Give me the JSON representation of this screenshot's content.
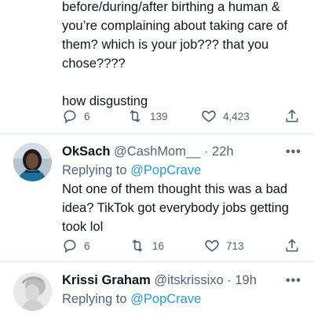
{
  "top_tweet": {
    "lines": [
      "before/during/after birthing a human &",
      "you’re complaining about taking care of",
      "them? which is your job??? that you",
      "chose????",
      "",
      "how disgusting"
    ],
    "stats": {
      "replies": "6",
      "retweets": "139",
      "likes": "4,423"
    }
  },
  "replies": [
    {
      "name": "OkSach",
      "handle": "@CashMom__",
      "separator": "·",
      "time": "22h",
      "replying_prefix": "Replying to",
      "replying_to": "@PopCrave",
      "lines": [
        "Not one of them thought this was a bad",
        "idea? TikTok got everybody jobs getting",
        "took lol"
      ],
      "stats": {
        "replies": "6",
        "retweets": "16",
        "likes": "713"
      },
      "more": "•••"
    },
    {
      "name": "Krissi Graham",
      "handle": "@itskrissixo",
      "separator": "·",
      "time": "19h",
      "replying_prefix": "Replying to",
      "replying_to": "@PopCrave",
      "lines": [],
      "more": "•••"
    }
  ],
  "icons": {
    "reply": "reply-icon",
    "retweet": "retweet-icon",
    "like": "heart-icon",
    "share": "share-icon",
    "more": "more-icon"
  },
  "colors": {
    "link": "#1d9bf0",
    "muted": "#536471",
    "text": "#0f1419",
    "divider": "#e6ecf0"
  }
}
